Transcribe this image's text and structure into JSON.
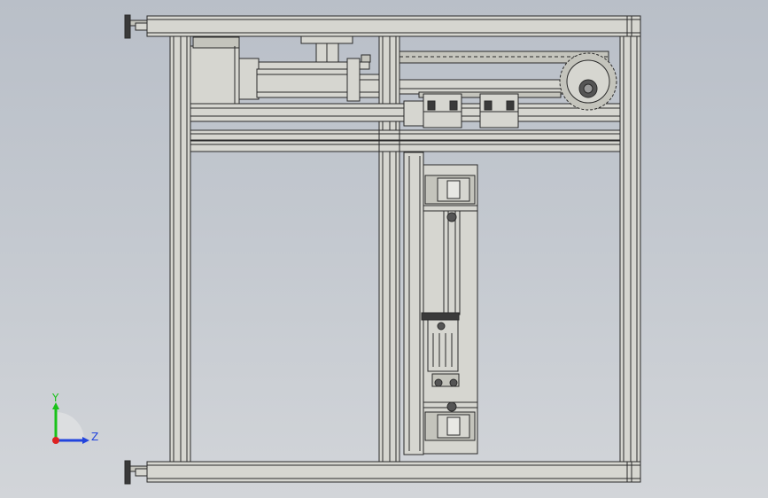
{
  "viewport": {
    "background_top": "#b9bfc8",
    "background_bottom": "#d2d5d9",
    "model_fill": "#d6d6d0",
    "model_stroke": "#2a2a2a",
    "part_shade": "#c4c4bc"
  },
  "triad": {
    "y_label": "Y",
    "z_label": "Z",
    "y_color": "#19c219",
    "z_color": "#2244dd",
    "origin_color": "#dd2222"
  }
}
